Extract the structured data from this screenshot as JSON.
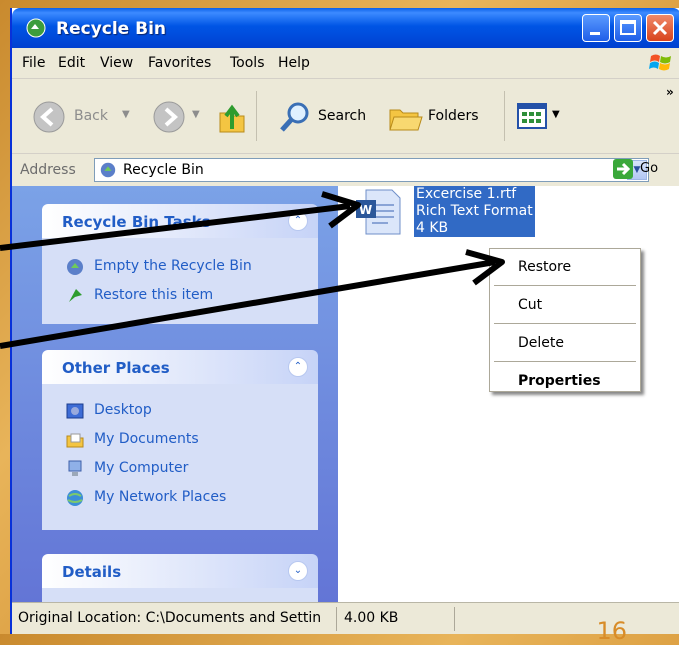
{
  "window": {
    "title": "Recycle Bin"
  },
  "menubar": {
    "items": [
      "File",
      "Edit",
      "View",
      "Favorites",
      "Tools",
      "Help"
    ]
  },
  "toolbar": {
    "back": "Back",
    "search": "Search",
    "folders": "Folders"
  },
  "address": {
    "label": "Address",
    "value": "Recycle Bin",
    "go": "Go"
  },
  "tasks": {
    "title": "Recycle Bin Tasks",
    "items": [
      "Empty the Recycle Bin",
      "Restore this item"
    ]
  },
  "other_places": {
    "title": "Other Places",
    "items": [
      "Desktop",
      "My Documents",
      "My Computer",
      "My Network Places"
    ]
  },
  "details": {
    "title": "Details"
  },
  "file": {
    "name": "Excercise 1.rtf",
    "type": "Rich Text Format",
    "size": "4 KB"
  },
  "context_menu": {
    "items": [
      "Restore",
      "Cut",
      "Delete",
      "Properties"
    ]
  },
  "status": {
    "location": "Original Location: C:\\Documents and Settin",
    "size": "4.00 KB"
  },
  "slide": {
    "page": "16"
  },
  "icons": {
    "title": "recycle-bin-icon",
    "file": "word-document-icon"
  }
}
